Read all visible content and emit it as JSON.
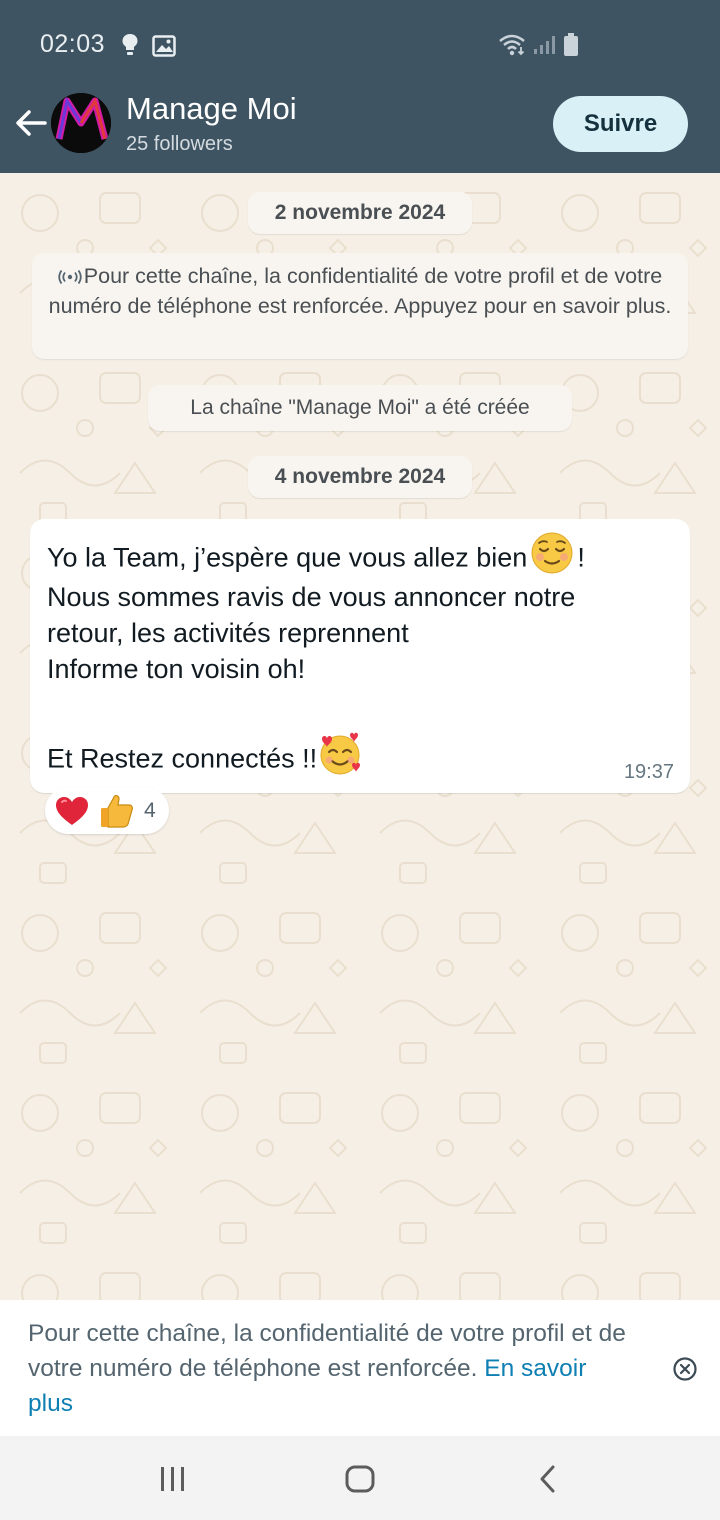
{
  "status_bar": {
    "time": "02:03",
    "icons": [
      "lightbulb-icon",
      "image-icon",
      "wifi-icon",
      "signal-icon",
      "battery-icon"
    ]
  },
  "header": {
    "title": "Manage Moi",
    "followers": "25 followers",
    "follow_button": "Suivre",
    "avatar_label": "MANAGE-MOI"
  },
  "chat": {
    "date_1": "2 novembre 2024",
    "privacy_note": "Pour cette chaîne, la confidentialité de votre profil et de votre numéro de téléphone est renforcée. Appuyez pour en savoir plus.",
    "created_note": "La chaîne \"Manage Moi\" a été créée",
    "date_2": "4 novembre 2024",
    "message": {
      "line1": "Yo la Team, j’espère que vous allez bien",
      "line1_end": "!",
      "line2": "Nous sommes ravis de vous annoncer notre",
      "line3": "retour, les activités reprennent",
      "line4": "Informe ton voisin oh!",
      "line5": "Et Restez connectés !!",
      "time": "19:37"
    },
    "reactions": {
      "emojis": [
        "heart",
        "thumbs-up"
      ],
      "count": "4"
    }
  },
  "notice": {
    "text": "Pour cette chaîne, la confidentialité de votre profil et de votre numéro de téléphone est renforcée. ",
    "link": "En savoir plus"
  },
  "colors": {
    "header": "#3f5462",
    "chat_bg": "#f5efe6",
    "link": "#0d7fb3",
    "follow_bg": "#d9f0f6"
  }
}
